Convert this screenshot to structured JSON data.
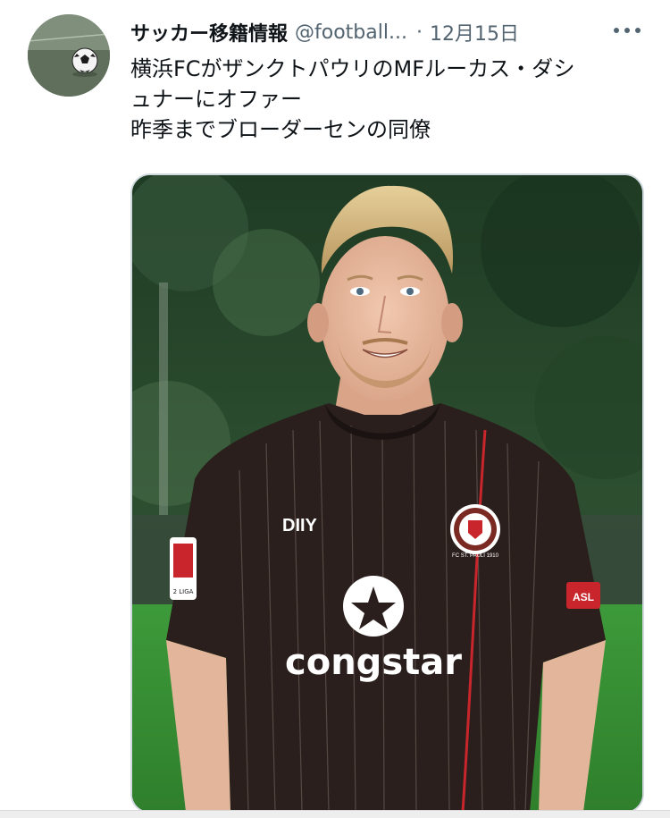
{
  "tweet": {
    "display_name": "サッカー移籍情報",
    "handle": "@football...",
    "separator": "·",
    "date": "12月15日",
    "more_icon": "more-horizontal-icon",
    "text_lines": [
      "横浜FCがザンクトパウリのMFルーカス・ダシ",
      "ュナーにオファー",
      "昨季までブローダーセンの同僚"
    ],
    "media": {
      "jersey_sponsor": "congstar",
      "jersey_brand": "DIIY",
      "crest_text": "FC ST. PAULI 1910",
      "sleeve_patch_right": "ASL",
      "sleeve_patch_left": "2 LIGA"
    }
  },
  "colors": {
    "text_primary": "#0f1419",
    "text_secondary": "#536471",
    "media_border": "#cfd9de",
    "jersey_brown": "#2a1f1c",
    "jersey_red_stripe": "#c8262c"
  }
}
